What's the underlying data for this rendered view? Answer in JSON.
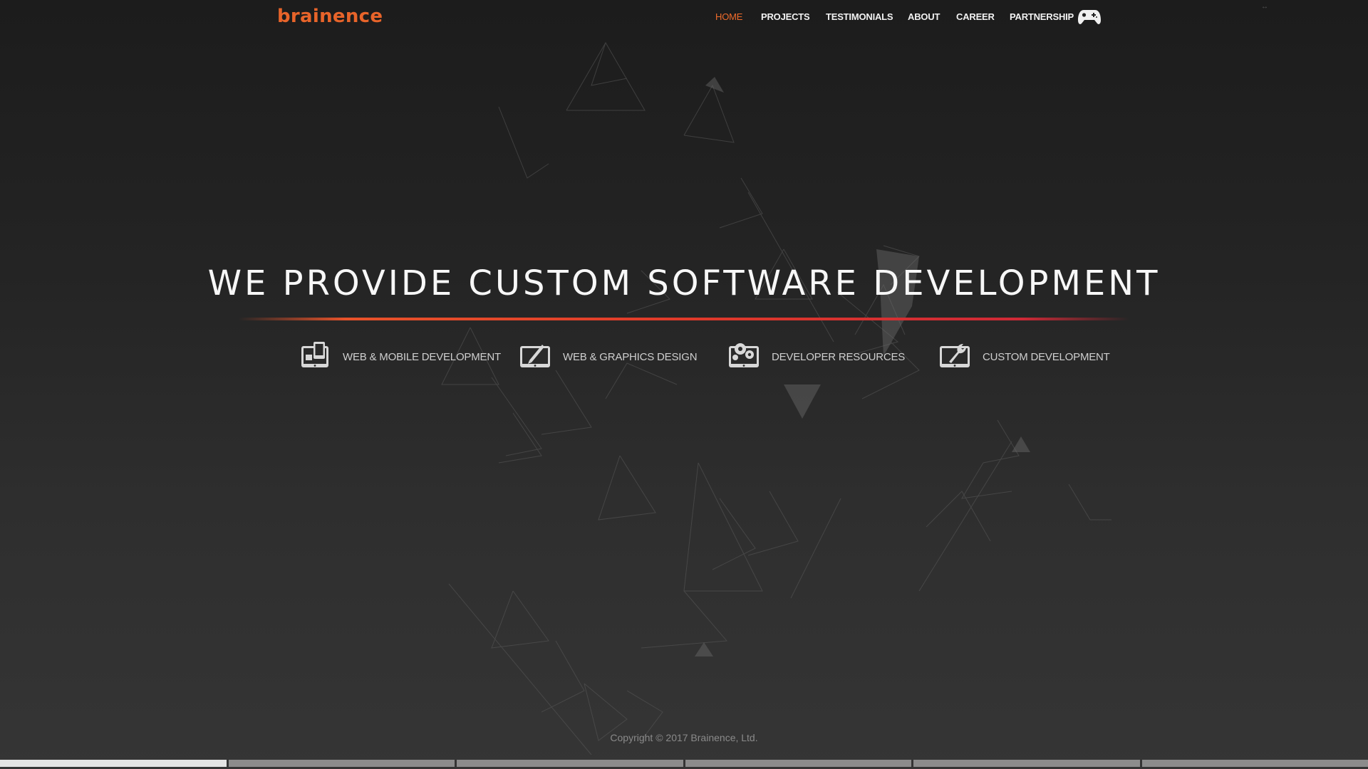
{
  "header": {
    "logo_text": "brainence",
    "nav": [
      {
        "label": "HOME",
        "active": true
      },
      {
        "label": "PROJECTS",
        "active": false
      },
      {
        "label": "TESTIMONIALS",
        "active": false
      },
      {
        "label": "ABOUT",
        "active": false
      },
      {
        "label": "CAREER",
        "active": false
      },
      {
        "label": "PARTNERSHIP",
        "active": false
      }
    ],
    "game_icon": "gamepad-icon"
  },
  "hero": {
    "headline": "WE PROVIDE CUSTOM SOFTWARE DEVELOPMENT"
  },
  "services": [
    {
      "label": "WEB & MOBILE DEVELOPMENT",
      "icon": "devices-icon"
    },
    {
      "label": "WEB & GRAPHICS DESIGN",
      "icon": "pen-tablet-icon"
    },
    {
      "label": "DEVELOPER RESOURCES",
      "icon": "gears-tablet-icon"
    },
    {
      "label": "CUSTOM DEVELOPMENT",
      "icon": "wrench-tablet-icon"
    }
  ],
  "footer": {
    "copyright": "Copyright © 2017 Brainence, Ltd."
  },
  "slider": {
    "segment_count": 6,
    "current_index": 0
  },
  "colors": {
    "accent": "#ef6b2b",
    "divider_start": "#e8532a",
    "divider_end": "#cf2936",
    "text": "#f7f7f7",
    "service_text": "#cfcfcf"
  }
}
